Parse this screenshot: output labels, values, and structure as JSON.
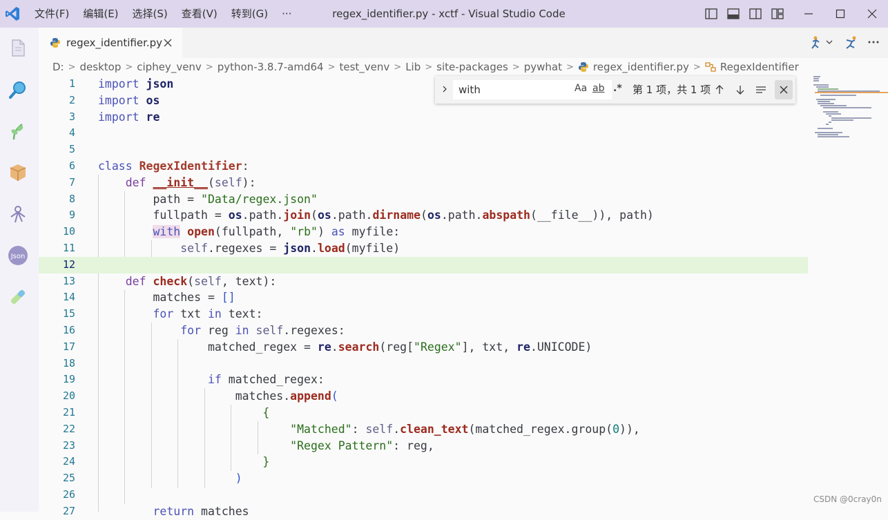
{
  "titlebar": {
    "menus": [
      "文件(F)",
      "编辑(E)",
      "选择(S)",
      "查看(V)",
      "转到(G)",
      "···"
    ],
    "title": "regex_identifier.py - xctf - Visual Studio Code",
    "icons": [
      "layout-sidebar-left-icon",
      "layout-panel-icon",
      "layout-sidebar-right-icon",
      "layout-custom-icon",
      "minimize-icon",
      "maximize-icon",
      "close-icon"
    ]
  },
  "activity": [
    "explorer-icon",
    "search-icon",
    "source-control-icon",
    "extensions-icon",
    "run-debug-icon",
    "json-icon",
    "testing-icon"
  ],
  "tab": {
    "name": "regex_identifier.py"
  },
  "breadcrumb": {
    "items": [
      "D:",
      "desktop",
      "ciphey_venv",
      "python-3.8.7-amd64",
      "test_venv",
      "Lib",
      "site-packages",
      "pywhat",
      "regex_identifier.py",
      "RegexIdentifier"
    ]
  },
  "find": {
    "value": "with",
    "case_label": "Aa",
    "word_label": "ab",
    "regex_label": ".*",
    "result": "第 1 项，共 1 项"
  },
  "editor": {
    "current_line": 12,
    "lines": [
      {
        "n": "1"
      },
      {
        "n": "2"
      },
      {
        "n": "3"
      },
      {
        "n": "4"
      },
      {
        "n": "5"
      },
      {
        "n": "6"
      },
      {
        "n": "7"
      },
      {
        "n": "8"
      },
      {
        "n": "9"
      },
      {
        "n": "10"
      },
      {
        "n": "11"
      },
      {
        "n": "12"
      },
      {
        "n": "13"
      },
      {
        "n": "14"
      },
      {
        "n": "15"
      },
      {
        "n": "16"
      },
      {
        "n": "17"
      },
      {
        "n": "18"
      },
      {
        "n": "19"
      },
      {
        "n": "20"
      },
      {
        "n": "21"
      },
      {
        "n": "22"
      },
      {
        "n": "23"
      },
      {
        "n": "24"
      },
      {
        "n": "25"
      },
      {
        "n": "26"
      },
      {
        "n": "27"
      }
    ],
    "tokens": {
      "import": "import",
      "json": "json",
      "os": "os",
      "re": "re",
      "class": "class",
      "RegexIdentifier": "RegexIdentifier",
      "def": "def",
      "init": "__init__",
      "self": "self",
      "path": "path",
      "data_path": "\"Data/regex.json\"",
      "fullpath": "fullpath",
      "join": "join",
      "dirname": "dirname",
      "abspath": "abspath",
      "file": "__file__",
      "with": "with",
      "open": "open",
      "rb": "\"rb\"",
      "as": "as",
      "myfile": "myfile",
      "regexes": "regexes",
      "load": "load",
      "check": "check",
      "text": "text",
      "matches": "matches",
      "for": "for",
      "txt": "txt",
      "in": "in",
      "reg": "reg",
      "matched_regex": "matched_regex",
      "search": "search",
      "regex_key": "\"Regex\"",
      "UNICODE": "UNICODE",
      "if": "if",
      "append": "append",
      "matched_key": "\"Matched\"",
      "clean_text": "clean_text",
      "group": "group",
      "zero": "0",
      "pattern_key": "\"Regex Pattern\"",
      "return": "return"
    }
  },
  "watermark": "CSDN @0cray0n"
}
